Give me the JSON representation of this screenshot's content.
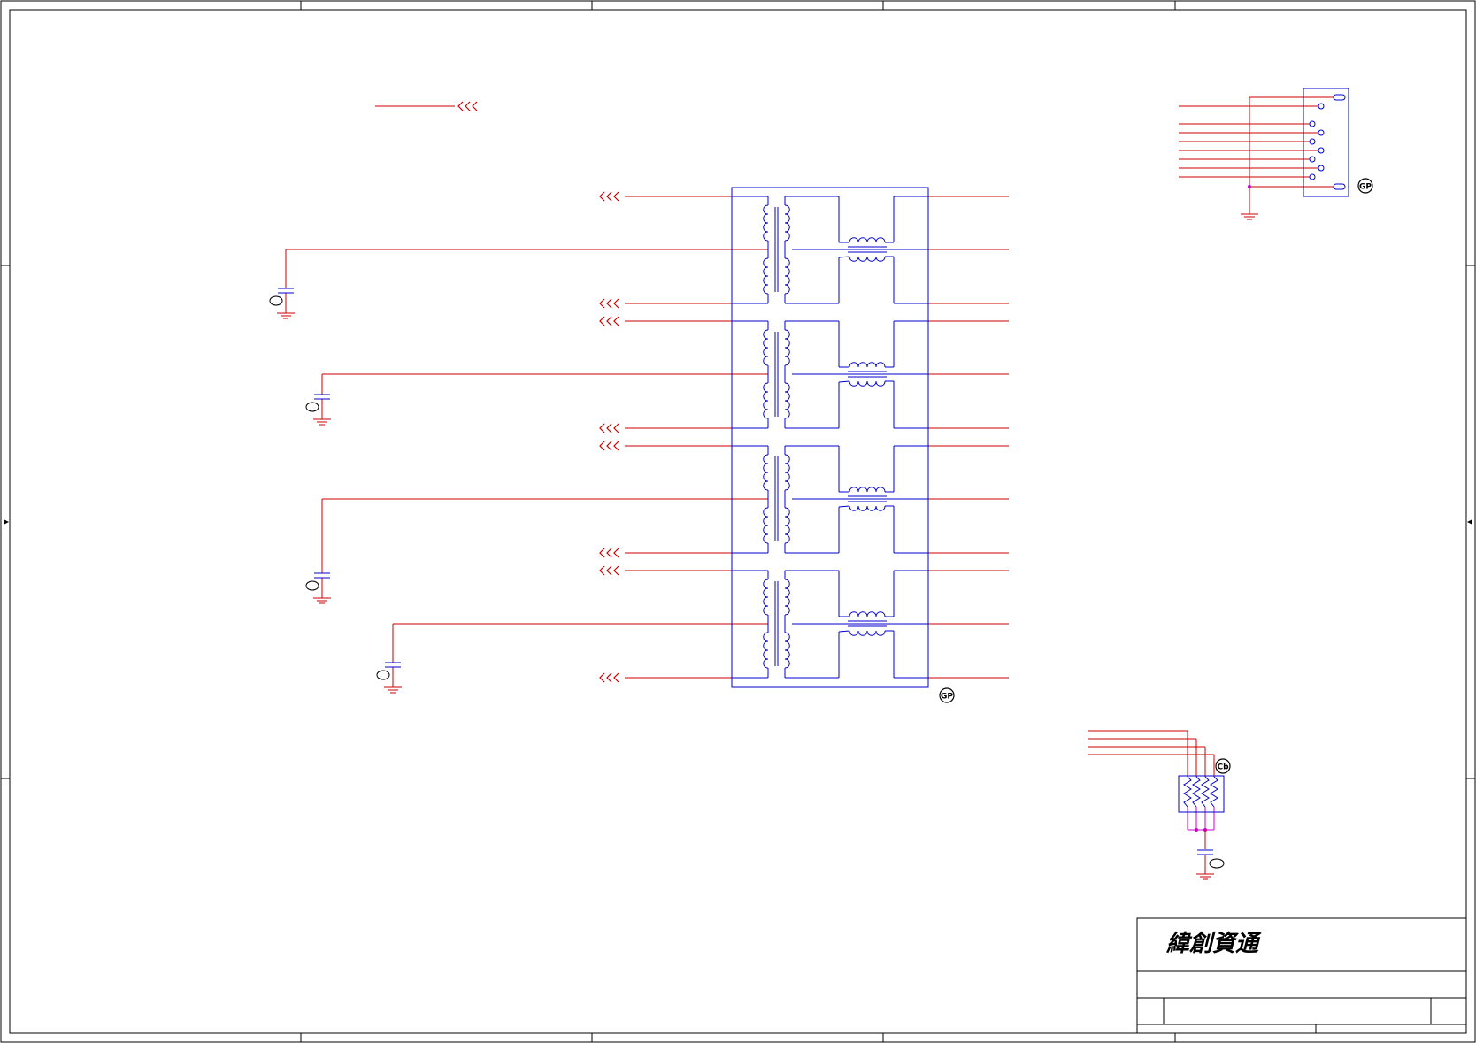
{
  "title_block": {
    "company": "緯創資通"
  },
  "markers": {
    "gp": "GP",
    "cb": "Cb"
  },
  "colors": {
    "wire": "#cc0000",
    "component": "#0000cc",
    "junction": "#cc00cc",
    "border": "#000000"
  }
}
